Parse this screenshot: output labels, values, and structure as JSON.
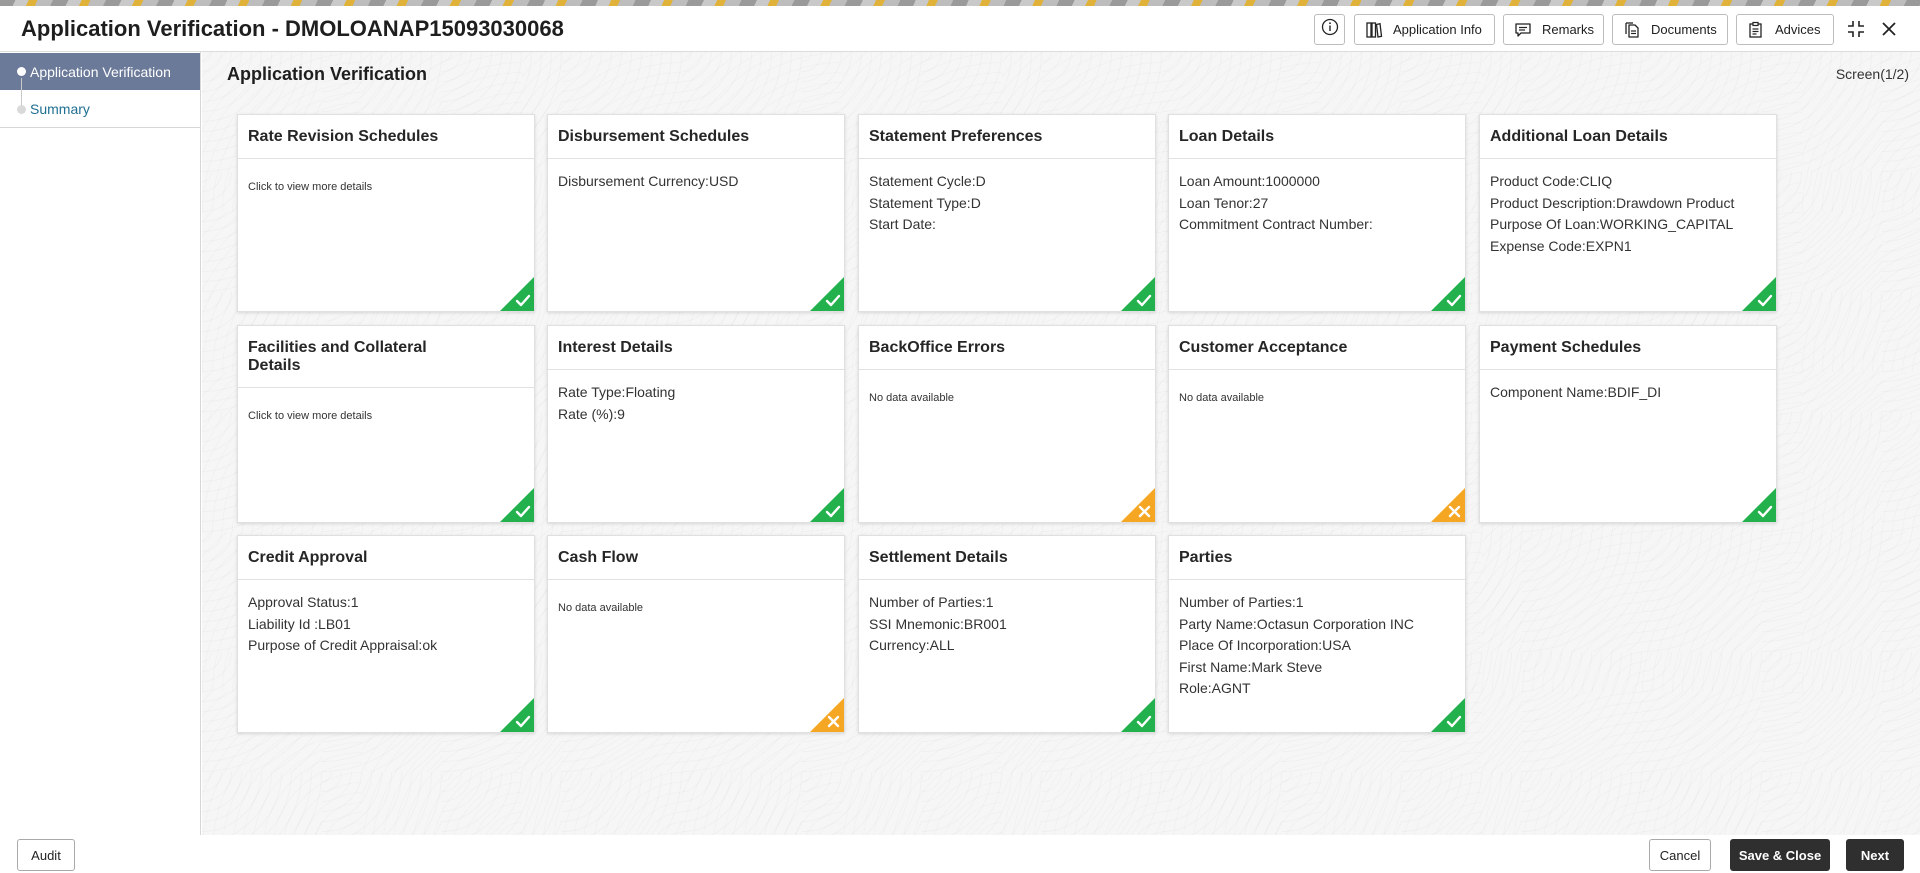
{
  "header": {
    "title": "Application Verification - DMOLOANAP15093030068",
    "buttons": {
      "application_info": "Application Info",
      "remarks": "Remarks",
      "documents": "Documents",
      "advices": "Advices"
    }
  },
  "sidebar": {
    "items": [
      {
        "label": "Application Verification"
      },
      {
        "label": "Summary"
      }
    ]
  },
  "main": {
    "title": "Application Verification",
    "screen_indicator": "Screen(1/2)"
  },
  "cards": [
    {
      "title": "Rate Revision Schedules",
      "note": "Click to view more details",
      "status": "complete"
    },
    {
      "title": "Disbursement Schedules",
      "lines": [
        "Disbursement Currency:USD"
      ],
      "status": "complete"
    },
    {
      "title": "Statement Preferences",
      "lines": [
        "Statement Cycle:D",
        "Statement Type:D",
        "Start Date:"
      ],
      "status": "complete"
    },
    {
      "title": "Loan Details",
      "lines": [
        "Loan Amount:1000000",
        "Loan Tenor:27",
        "Commitment Contract Number:"
      ],
      "status": "complete"
    },
    {
      "title": "Additional Loan Details",
      "lines": [
        "Product Code:CLIQ",
        "Product Description:Drawdown Product",
        "Purpose Of Loan:WORKING_CAPITAL",
        "Expense Code:EXPN1"
      ],
      "status": "complete"
    },
    {
      "title": "Facilities and Collateral Details",
      "note": "Click to view more details",
      "status": "complete"
    },
    {
      "title": "Interest Details",
      "lines": [
        "Rate Type:Floating",
        "Rate (%):9"
      ],
      "status": "complete"
    },
    {
      "title": "BackOffice Errors",
      "note": "No data available",
      "status": "incomplete"
    },
    {
      "title": "Customer Acceptance",
      "note": "No data available",
      "status": "incomplete"
    },
    {
      "title": "Payment Schedules",
      "lines": [
        "Component Name:BDIF_DI"
      ],
      "status": "complete"
    },
    {
      "title": "Credit Approval",
      "lines": [
        "Approval Status:1",
        "Liability Id :LB01",
        "Purpose of Credit Appraisal:ok"
      ],
      "status": "complete"
    },
    {
      "title": "Cash Flow",
      "note": "No data available",
      "status": "incomplete"
    },
    {
      "title": "Settlement Details",
      "lines": [
        "Number of Parties:1",
        "SSI Mnemonic:BR001",
        "Currency:ALL"
      ],
      "status": "complete"
    },
    {
      "title": "Parties",
      "lines": [
        "Number of Parties:1",
        "Party Name:Octasun Corporation INC",
        "Place Of Incorporation:USA",
        "First Name:Mark Steve",
        "Role:AGNT"
      ],
      "status": "complete"
    }
  ],
  "footer": {
    "audit": "Audit",
    "cancel": "Cancel",
    "save_close": "Save & Close",
    "next": "Next"
  },
  "colors": {
    "complete": "#22b14c",
    "incomplete": "#f5a623",
    "sidebar_active": "#6b7a99",
    "link": "#1f6f92"
  },
  "icons": [
    "info-icon",
    "book-icon",
    "comment-icon",
    "document-icon",
    "clipboard-icon",
    "collapse-icon",
    "close-icon",
    "checkmark-icon",
    "cross-icon"
  ]
}
